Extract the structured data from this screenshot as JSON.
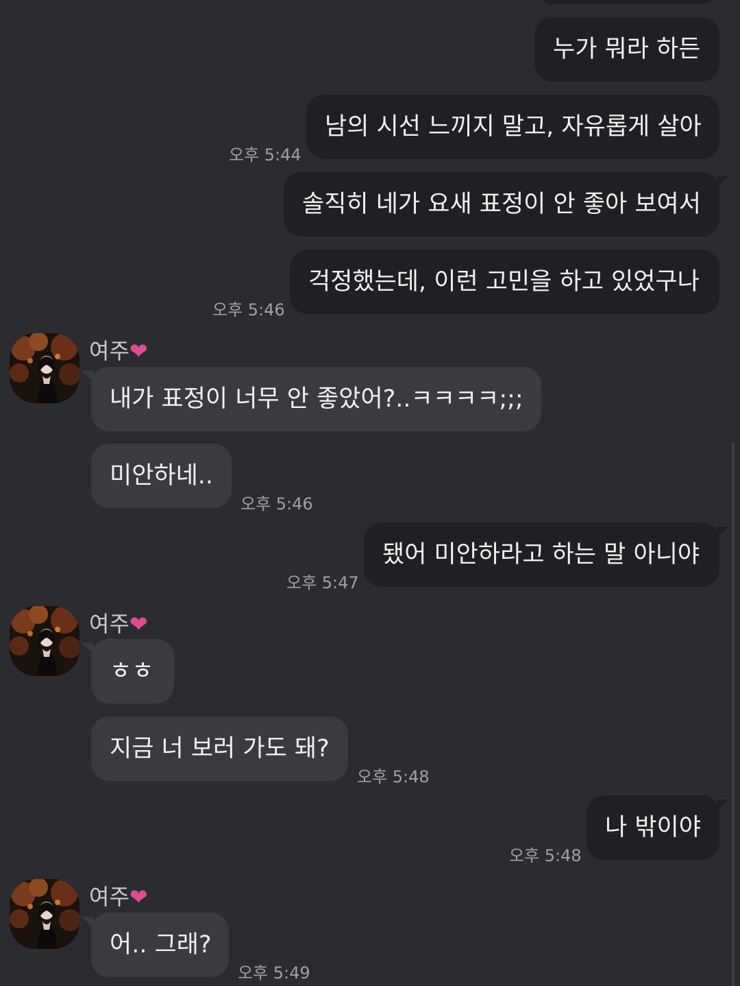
{
  "contact": {
    "name": "여주",
    "name_suffix_icon": "pink-heart-icon"
  },
  "messages": [
    {
      "side": "mine",
      "text": "누가 뭐라 하든",
      "time": ""
    },
    {
      "side": "mine",
      "text": "남의 시선 느끼지 말고, 자유롭게 살아",
      "time": "오후 5:44"
    },
    {
      "side": "mine",
      "text": "솔직히 네가 요새 표정이 안 좋아 보여서",
      "time": ""
    },
    {
      "side": "mine",
      "text": "걱정했는데, 이런 고민을 하고 있었구나",
      "time": "오후 5:46"
    },
    {
      "side": "theirs",
      "text": "내가 표정이 너무 안 좋았어?..ㅋㅋㅋㅋ;;;",
      "time": ""
    },
    {
      "side": "theirs",
      "text": "미안하네..",
      "time": "오후 5:46"
    },
    {
      "side": "mine",
      "text": "됐어 미안하라고 하는 말 아니야",
      "time": "오후 5:47"
    },
    {
      "side": "theirs",
      "text": "ㅎㅎ",
      "time": ""
    },
    {
      "side": "theirs",
      "text": "지금 너 보러 가도 돼?",
      "time": "오후 5:48"
    },
    {
      "side": "mine",
      "text": "나 밖이야",
      "time": "오후 5:48"
    },
    {
      "side": "theirs",
      "text": "어.. 그래?",
      "time": "오후 5:49"
    }
  ],
  "colors": {
    "background": "#2b2c30",
    "my_bubble": "#1f2024",
    "their_bubble": "#3a3b40",
    "text": "#f1f1f1",
    "timestamp": "#a0a1a6",
    "heart": "#e04b8f"
  }
}
